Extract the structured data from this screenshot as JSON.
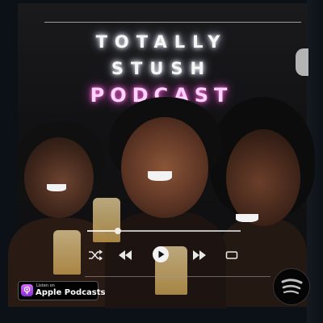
{
  "cover": {
    "title_line1": "TOTALLY",
    "title_line2": "STUSH",
    "title_line3": "PODCAST"
  },
  "player": {
    "progress": 0.2,
    "controls": [
      "shuffle-icon",
      "previous-icon",
      "play-icon",
      "next-icon",
      "repeat-icon"
    ]
  },
  "badge": {
    "small_text": "Listen on",
    "main_text": "Apple Podcasts"
  },
  "brand": {
    "spotify_icon": "spotify-icon"
  },
  "colors": {
    "podcast_glow": "#e04bd0",
    "white_glow": "#ffffff",
    "background": "#0b1116"
  }
}
